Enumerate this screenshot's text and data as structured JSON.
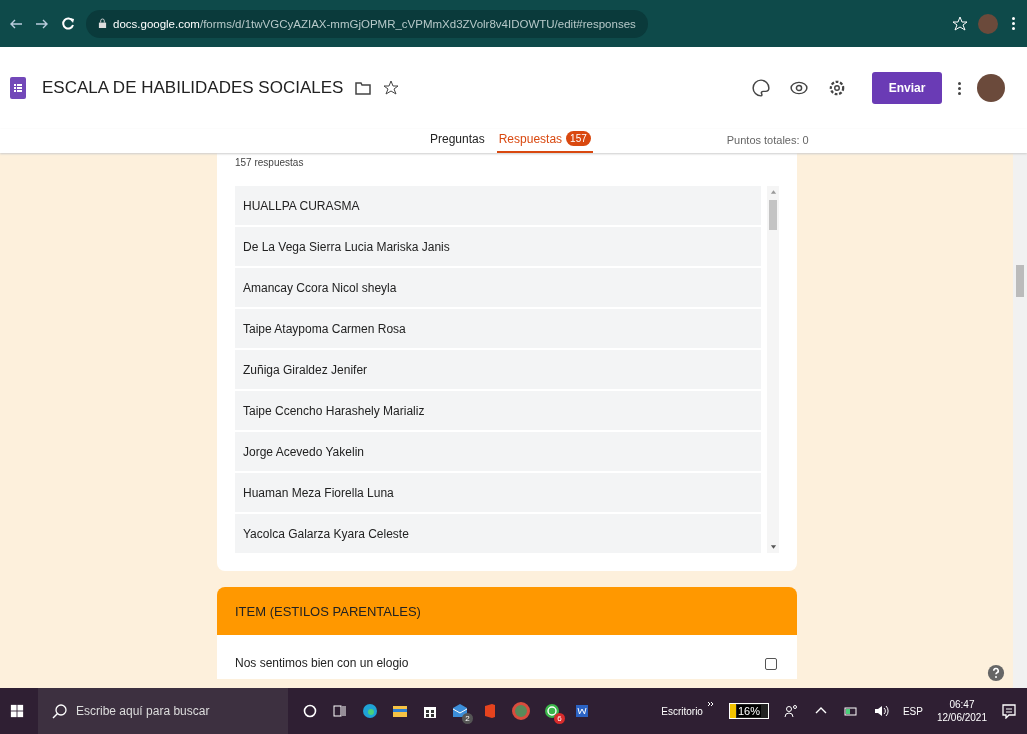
{
  "browser": {
    "url_host": "docs.google.com",
    "url_path": "/forms/d/1twVGCyAZIAX-mmGjOPMR_cVPMmXd3ZVolr8v4IDOWTU/edit#responses"
  },
  "form": {
    "title": "ESCALA DE HABILIDADES SOCIALES",
    "send_button": "Enviar"
  },
  "tabs": [
    {
      "label": "Preguntas",
      "selected": false
    },
    {
      "label": "Respuestas",
      "selected": true,
      "badge": "157"
    }
  ],
  "total_points": "Puntos totales: 0",
  "responses": {
    "count": "157 respuestas",
    "names": [
      "HUALLPA CURASMA",
      "De La Vega Sierra Lucia Mariska Janis",
      "Amancay Ccora Nicol sheyla",
      "Taipe Ataypoma Carmen Rosa",
      "Zuñiga Giraldez Jenifer",
      "Taipe Ccencho Harashely Marializ",
      "Jorge Acevedo Yakelin",
      "Huaman Meza Fiorella Luna",
      "Yacolca Galarza Kyara Celeste"
    ]
  },
  "section": {
    "title": "ITEM (ESTILOS PARENTALES)",
    "first_question": "Nos sentimos bien con un elogio"
  },
  "taskbar": {
    "search_placeholder": "Escribe aquí para buscar",
    "mail_badge": "2",
    "whatsapp_badge": "6",
    "desktop_label": "Escritorio",
    "battery": {
      "label": "16%",
      "level": 0.16
    },
    "language": "ESP",
    "time": "06:47",
    "date": "12/06/2021"
  }
}
